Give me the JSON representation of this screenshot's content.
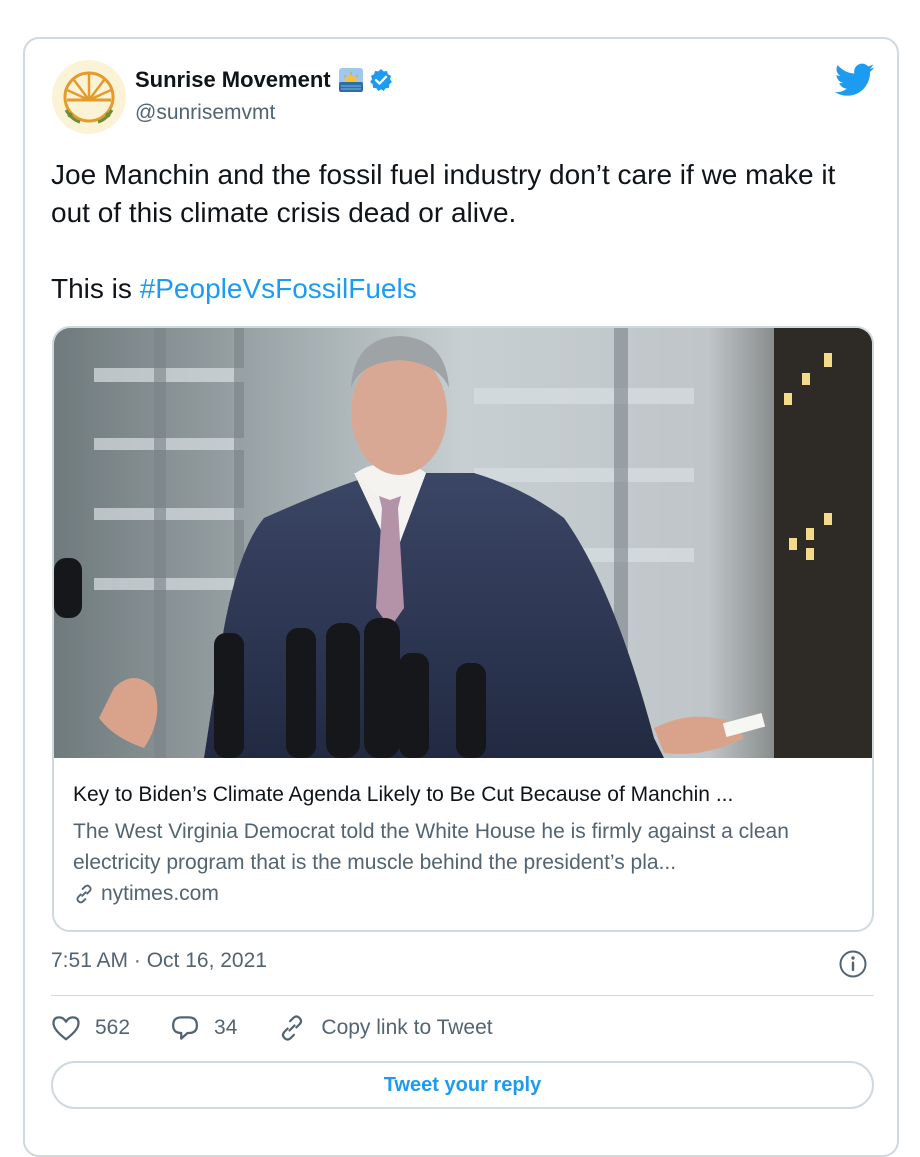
{
  "author": {
    "name": "Sunrise Movement",
    "handle": "@sunrisemvmt",
    "avatar_icon": "sunrise-logo",
    "name_emoji": "sunrise-emoji",
    "verified": true
  },
  "tweet": {
    "line1": "Joe Manchin and the fossil fuel industry don’t care if we make it out of this climate crisis dead or alive.",
    "line2_prefix": "This is ",
    "hashtag": "#PeopleVsFossilFuels"
  },
  "link_card": {
    "title": "Key to Biden’s Climate Agenda Likely to Be Cut Because of Manchin ...",
    "description": "The West Virginia Democrat told the White House he is firmly against a clean electricity program that is the muscle behind the president’s pla...",
    "domain": "nytimes.com"
  },
  "meta": {
    "timestamp": "7:51 AM · Oct 16, 2021"
  },
  "actions": {
    "likes": "562",
    "replies": "34",
    "copy_link": "Copy link to Tweet"
  },
  "reply_button": "Tweet your reply",
  "colors": {
    "accent": "#1d9bf0",
    "text": "#0f1419",
    "secondary": "#536471",
    "border": "#cfd9de"
  }
}
